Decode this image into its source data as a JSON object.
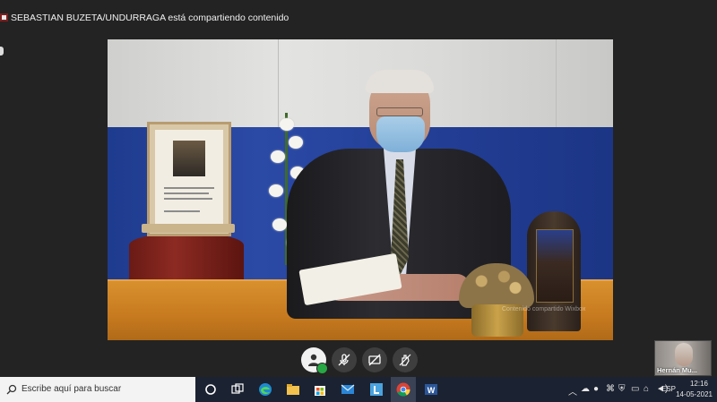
{
  "share_bar": {
    "text": "SEBASTIAN BUZETA/UNDURRAGA está compartiendo contenido"
  },
  "video": {
    "watermark": "Contenido compartido Wixbox"
  },
  "participant": {
    "name": "Hernán Mu..."
  },
  "controls": [
    {
      "icon": "avatar-icon",
      "status": "connected"
    },
    {
      "icon": "mic-off-icon"
    },
    {
      "icon": "video-off-icon"
    },
    {
      "icon": "raise-hand-icon"
    }
  ],
  "taskbar": {
    "search_placeholder": "Escribe aquí para buscar",
    "apps": [
      "cortana-icon",
      "task-view-icon",
      "edge-icon",
      "file-explorer-icon",
      "store-icon",
      "mail-icon",
      "l-app-icon",
      "chrome-icon",
      "word-icon"
    ],
    "language": "ESP",
    "time": "12:16",
    "date": "14-05-2021"
  },
  "colors": {
    "background": "#232323",
    "taskbar": "#1b2231",
    "status_green": "#27a844"
  }
}
